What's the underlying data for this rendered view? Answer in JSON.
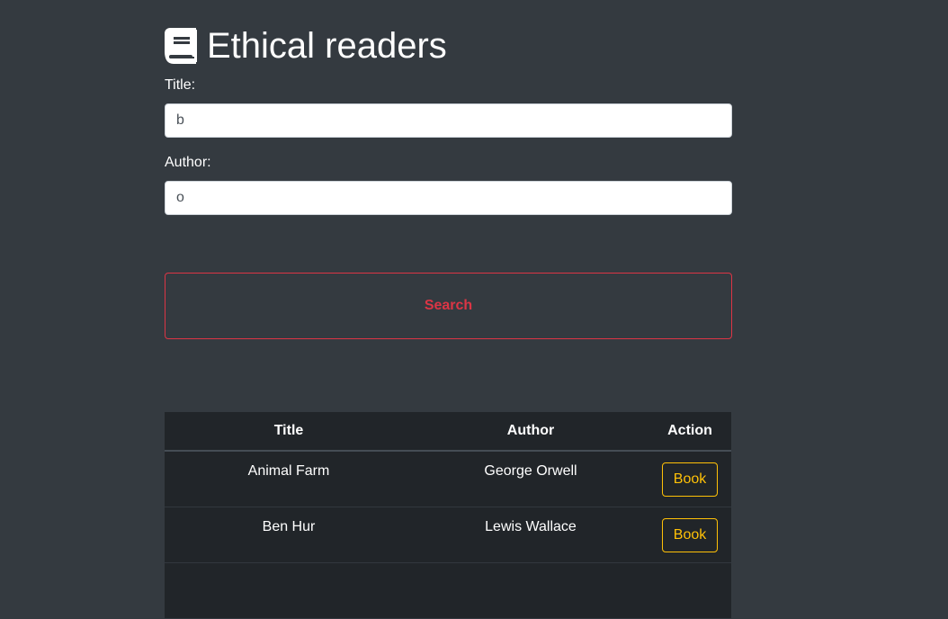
{
  "header": {
    "icon": "book-icon",
    "title": "Ethical readers"
  },
  "form": {
    "title_label": "Title:",
    "title_value": "b",
    "author_label": "Author:",
    "author_value": "o",
    "search_label": "Search"
  },
  "table": {
    "columns": [
      "Title",
      "Author",
      "Action"
    ],
    "rows": [
      {
        "title": "Animal Farm",
        "author": "George Orwell",
        "action": "Book"
      },
      {
        "title": "Ben Hur",
        "author": "Lewis Wallace",
        "action": "Book"
      }
    ]
  },
  "colors": {
    "background": "#343a40",
    "search_accent": "#dc3545",
    "book_accent": "#ffc107",
    "table_bg": "#212529"
  }
}
